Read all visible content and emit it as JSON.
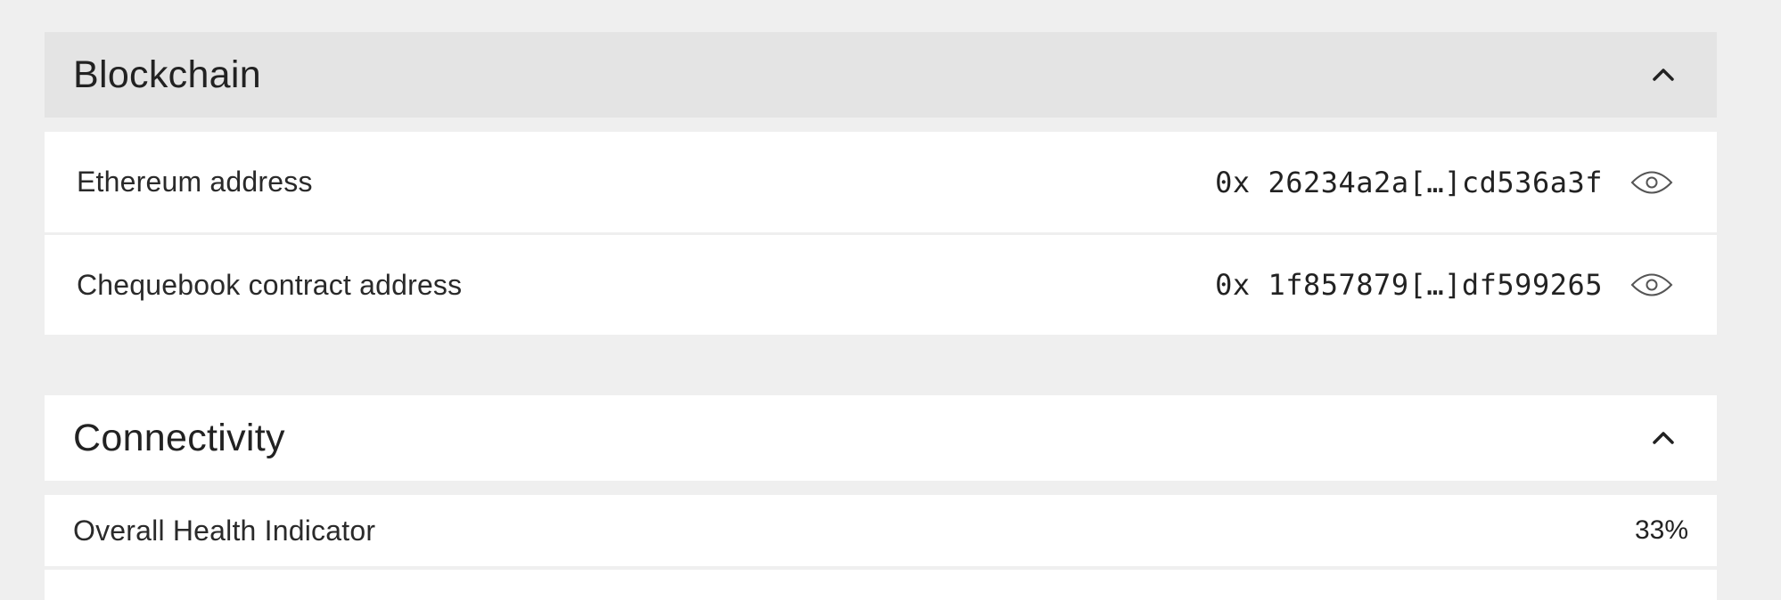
{
  "blockchain": {
    "title": "Blockchain",
    "collapse_icon": "chevron-up-icon",
    "rows": [
      {
        "label": "Ethereum address",
        "value": "0x 26234a2a[…]cd536a3f",
        "icon": "eye-icon"
      },
      {
        "label": "Chequebook contract address",
        "value": "0x 1f857879[…]df599265",
        "icon": "eye-icon"
      }
    ]
  },
  "connectivity": {
    "title": "Connectivity",
    "collapse_icon": "chevron-up-icon",
    "rows": [
      {
        "label": "Overall Health Indicator",
        "value": "33%"
      }
    ]
  },
  "colors": {
    "page_background": "#efefef",
    "header_expanded_background": "#e4e4e4",
    "card_background": "#ffffff",
    "text": "#222222"
  }
}
